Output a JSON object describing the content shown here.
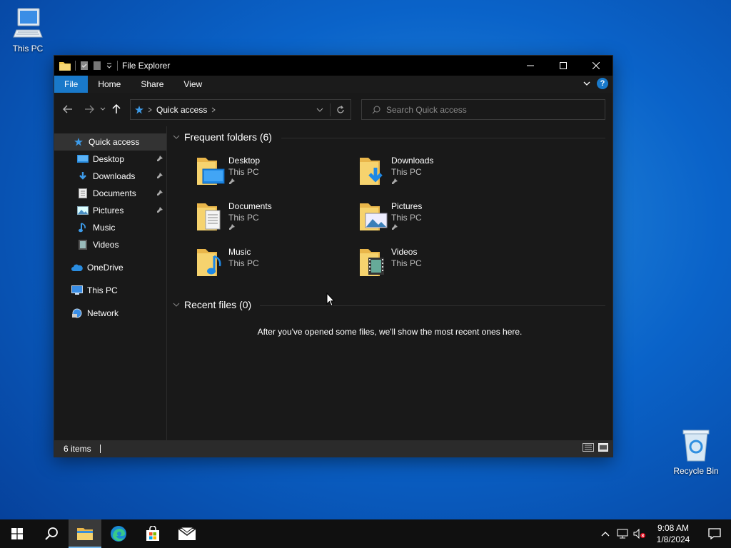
{
  "desktop": {
    "this_pc_label": "This PC",
    "recycle_bin_label": "Recycle Bin"
  },
  "window": {
    "title": "File Explorer",
    "ribbon_tabs": [
      "File",
      "Home",
      "Share",
      "View"
    ],
    "address_location": "Quick access",
    "search_placeholder": "Search Quick access",
    "accent_color": "#1979ca"
  },
  "navpane": {
    "items": [
      {
        "label": "Quick access",
        "icon": "star-icon",
        "pinned": false
      },
      {
        "label": "Desktop",
        "icon": "desktop-folder-icon",
        "pinned": true
      },
      {
        "label": "Downloads",
        "icon": "download-arrow-icon",
        "pinned": true
      },
      {
        "label": "Documents",
        "icon": "documents-icon",
        "pinned": true
      },
      {
        "label": "Pictures",
        "icon": "pictures-icon",
        "pinned": true
      },
      {
        "label": "Music",
        "icon": "music-note-icon",
        "pinned": false
      },
      {
        "label": "Videos",
        "icon": "videos-icon",
        "pinned": false
      },
      {
        "label": "OneDrive",
        "icon": "cloud-icon",
        "pinned": false
      },
      {
        "label": "This PC",
        "icon": "computer-icon",
        "pinned": false
      },
      {
        "label": "Network",
        "icon": "network-icon",
        "pinned": false
      }
    ]
  },
  "content": {
    "frequent_header": "Frequent folders (6)",
    "recent_header": "Recent files (0)",
    "recent_empty_message": "After you've opened some files, we'll show the most recent ones here.",
    "folders": [
      {
        "name": "Desktop",
        "location": "This PC",
        "pinned": true
      },
      {
        "name": "Downloads",
        "location": "This PC",
        "pinned": true
      },
      {
        "name": "Documents",
        "location": "This PC",
        "pinned": true
      },
      {
        "name": "Pictures",
        "location": "This PC",
        "pinned": true
      },
      {
        "name": "Music",
        "location": "This PC",
        "pinned": false
      },
      {
        "name": "Videos",
        "location": "This PC",
        "pinned": false
      }
    ]
  },
  "statusbar": {
    "item_count": "6 items"
  },
  "taskbar": {
    "time": "9:08 AM",
    "date": "1/8/2024"
  }
}
